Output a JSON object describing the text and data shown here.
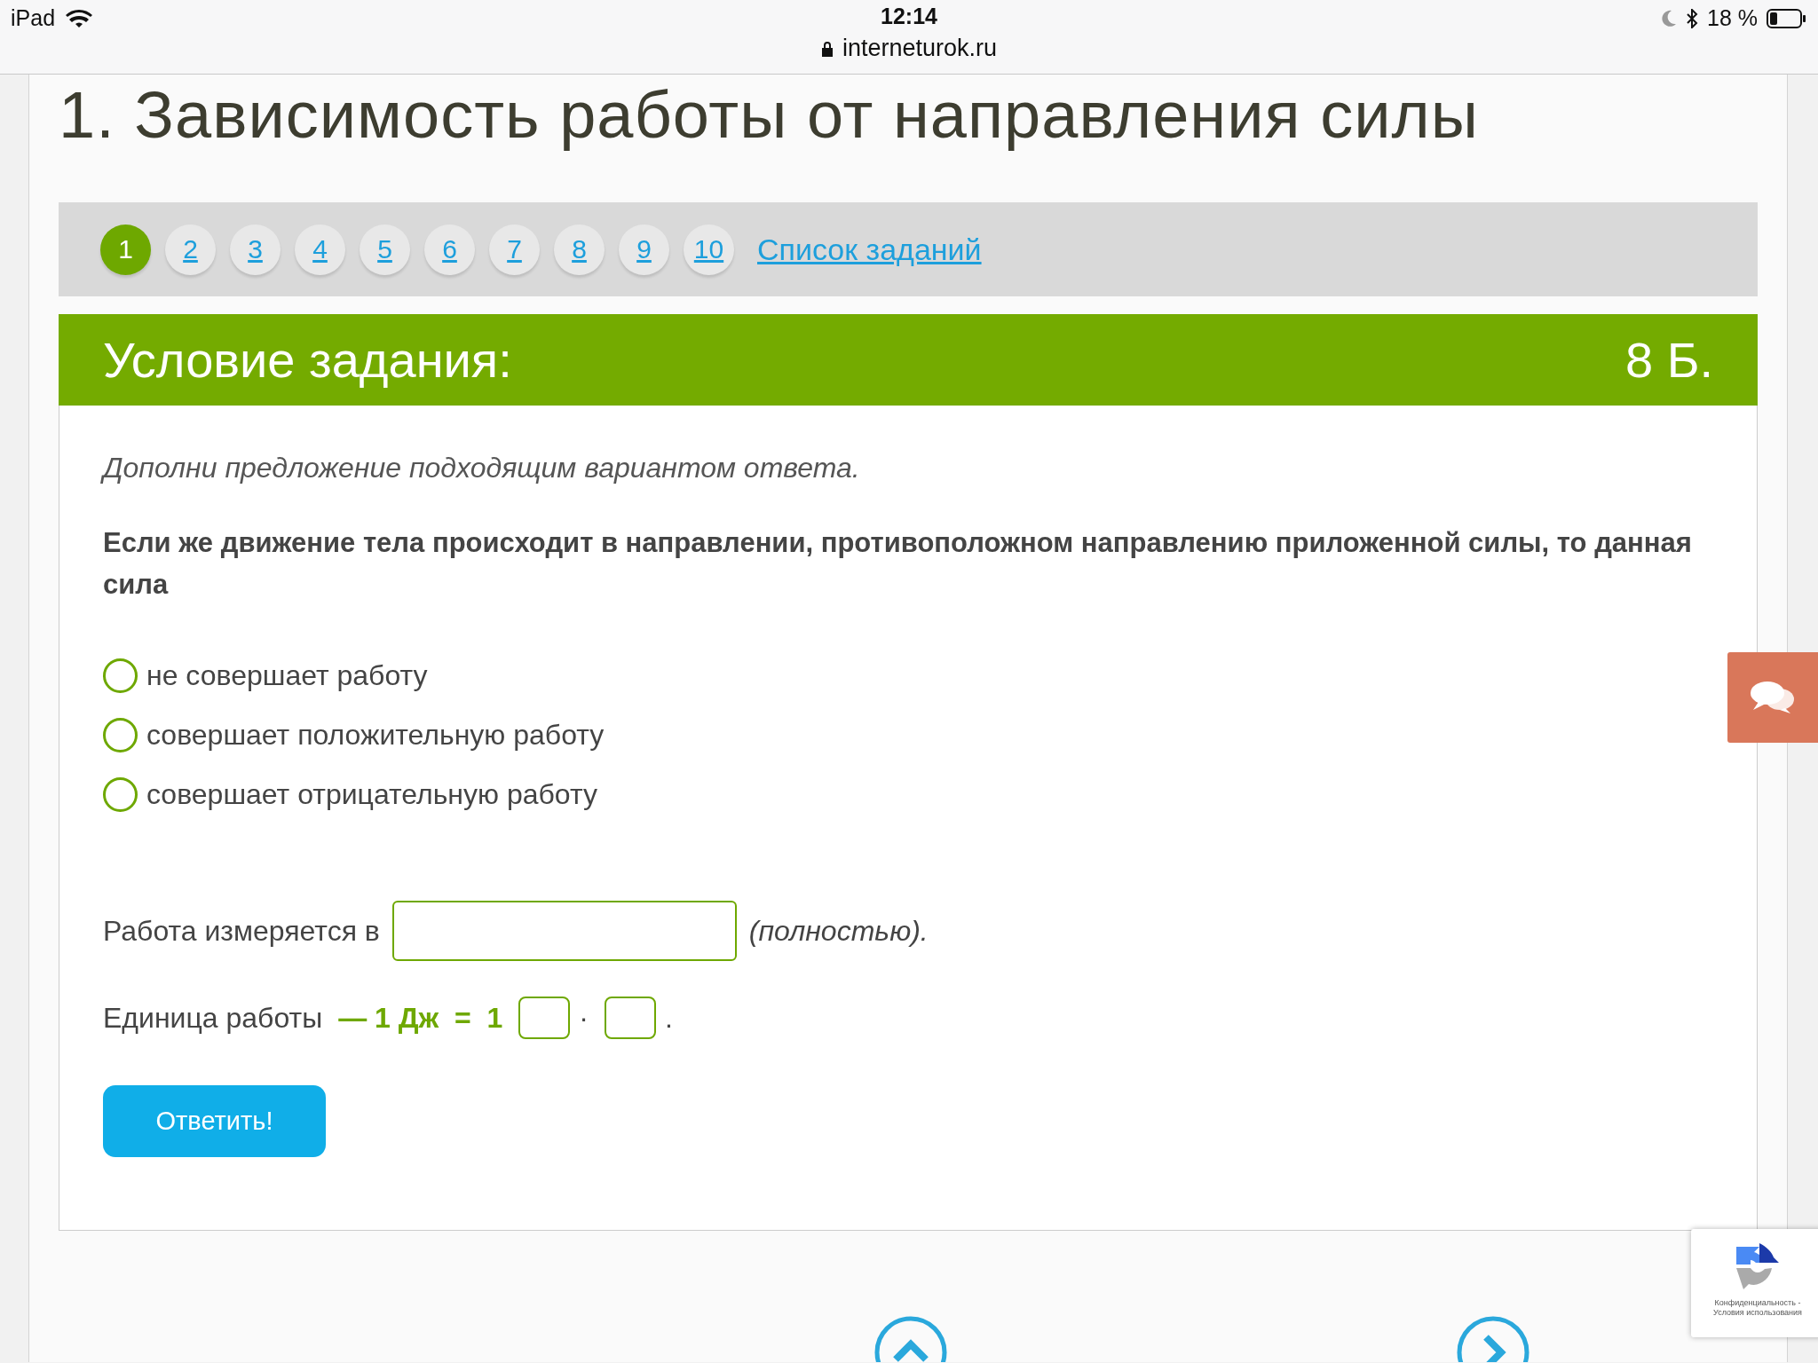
{
  "status_bar": {
    "device": "iPad",
    "time": "12:14",
    "url": "interneturok.ru",
    "battery": "18 %"
  },
  "title": "1. Зависимость работы от направления силы",
  "pager": {
    "pages": [
      {
        "label": "1",
        "selected": true
      },
      {
        "label": "2",
        "selected": false
      },
      {
        "label": "3",
        "selected": false
      },
      {
        "label": "4",
        "selected": false
      },
      {
        "label": "5",
        "selected": false
      },
      {
        "label": "6",
        "selected": false
      },
      {
        "label": "7",
        "selected": false
      },
      {
        "label": "8",
        "selected": false
      },
      {
        "label": "9",
        "selected": false
      },
      {
        "label": "10",
        "selected": false
      }
    ],
    "list_link": "Список заданий"
  },
  "task": {
    "header": "Условие задания:",
    "points": "8 Б.",
    "instruction": "Дополни предложение подходящим вариантом ответа.",
    "question": "Если же движение тела происходит в направлении, противоположном направлению приложенной силы, то данная сила",
    "options": [
      {
        "label": "не совершает работу",
        "selected": false
      },
      {
        "label": "совершает положительную работу",
        "selected": false
      },
      {
        "label": "совершает отрицательную работу",
        "selected": false
      }
    ],
    "fill_in": {
      "before": "Работа измеряется в",
      "after": "(полностью)."
    },
    "unit_line": {
      "label": "Единица работы",
      "formula": "— 1 Дж  =  1",
      "dot": "·",
      "end": "."
    },
    "submit": "Ответить!"
  },
  "recaptcha": {
    "lines": [
      "Конфиденциальность -",
      "Условия использования"
    ]
  }
}
